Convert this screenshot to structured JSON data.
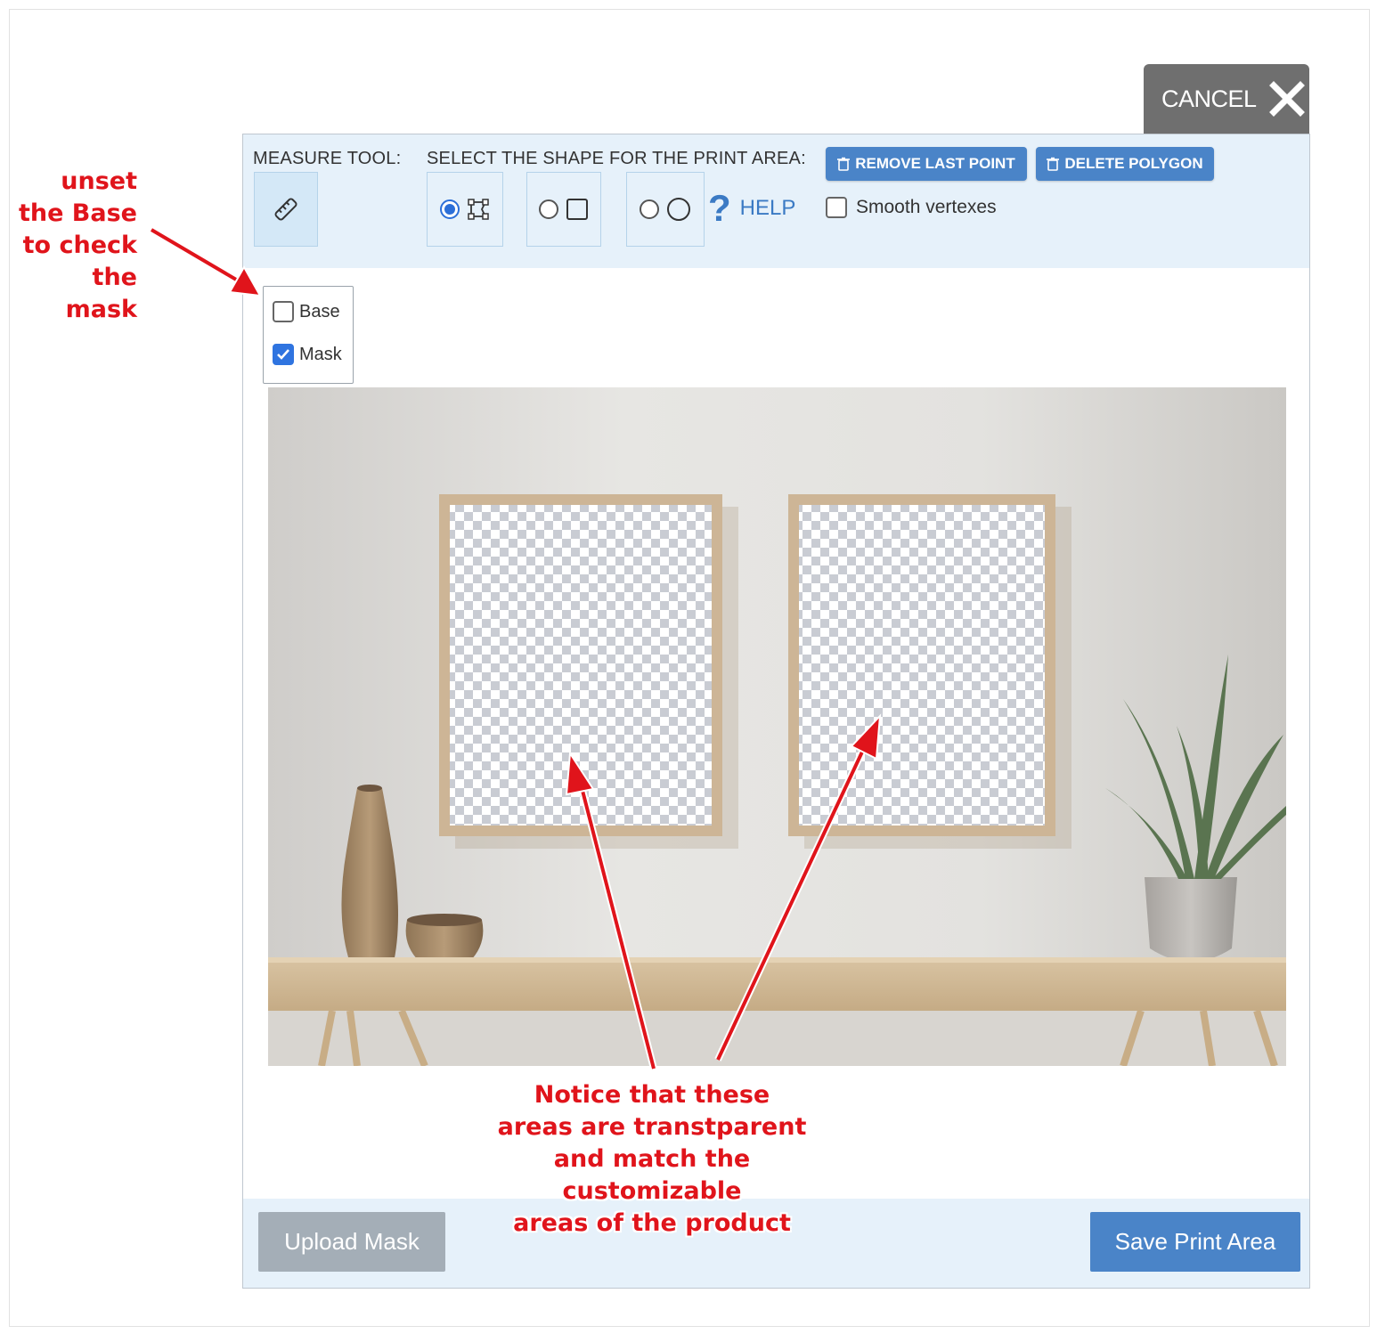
{
  "cancel": {
    "label": "CANCEL"
  },
  "toolbar": {
    "measure_label": "MEASURE TOOL:",
    "shape_label": "SELECT THE SHAPE FOR THE PRINT AREA:",
    "help_label": "HELP",
    "remove_last_point": "REMOVE LAST POINT",
    "delete_polygon": "DELETE POLYGON",
    "smooth_vertexes": "Smooth vertexes",
    "shapes": [
      {
        "icon": "polygon-icon",
        "selected": true
      },
      {
        "icon": "rectangle-icon",
        "selected": false
      },
      {
        "icon": "ellipse-icon",
        "selected": false
      }
    ]
  },
  "layers": {
    "base": {
      "label": "Base",
      "checked": false
    },
    "mask": {
      "label": "Mask",
      "checked": true
    }
  },
  "footer": {
    "upload_mask": "Upload Mask",
    "save_print_area": "Save Print Area"
  },
  "annotations": {
    "left": [
      "unset",
      "the Base",
      "to check",
      "the mask"
    ],
    "bottom": [
      "Notice that these",
      "areas are transtparent",
      "and match the customizable",
      "areas of the product"
    ]
  },
  "colors": {
    "accent": "#4a84c8",
    "annotation": "#e0141b",
    "toolbar_bg": "#e6f1fa",
    "cancel_bg": "#6f6f6f"
  }
}
